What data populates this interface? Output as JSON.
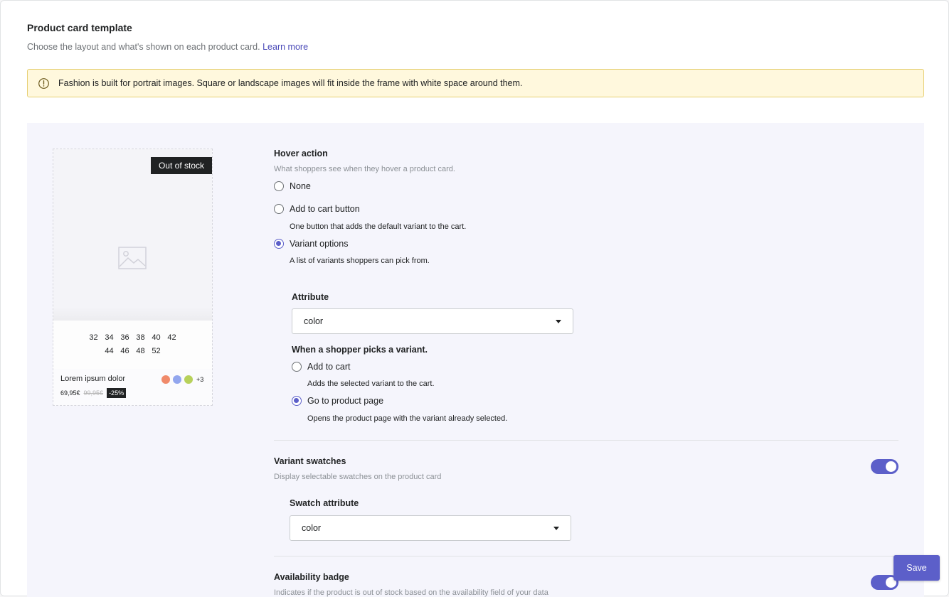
{
  "header": {
    "title": "Product card template",
    "description": "Choose the layout and what's shown on each product card.",
    "learn_more": "Learn more"
  },
  "banner": {
    "icon": "warning-circle-icon",
    "text": "Fashion is built for portrait images. Square or landscape images will fit inside the frame with white space around them."
  },
  "preview": {
    "badge": "Out of stock",
    "image_icon": "image-placeholder-icon",
    "sizes_row1": [
      "32",
      "34",
      "36",
      "38",
      "40",
      "42"
    ],
    "sizes_row2": [
      "44",
      "46",
      "48",
      "52"
    ],
    "product_name": "Lorem ipsum dolor",
    "swatch_colors": [
      "#f08a6a",
      "#92a6ee",
      "#b7d15a"
    ],
    "swatch_more": "+3",
    "price": "69,95€",
    "price_old": "99,95€",
    "discount": "-25%"
  },
  "hover_action": {
    "title": "Hover action",
    "description": "What shoppers see when they hover a product card.",
    "options": [
      {
        "label": "None",
        "help": "",
        "selected": false
      },
      {
        "label": "Add to cart button",
        "help": "One button that adds the default variant to the cart.",
        "selected": false
      },
      {
        "label": "Variant options",
        "help": "A list of variants shoppers can pick from.",
        "selected": true
      }
    ],
    "attribute_label": "Attribute",
    "attribute_value": "color",
    "pick_title": "When a shopper picks a variant.",
    "pick_options": [
      {
        "label": "Add to cart",
        "help": "Adds the selected variant to the cart.",
        "selected": false
      },
      {
        "label": "Go to product page",
        "help": "Opens the product page with the variant already selected.",
        "selected": true
      }
    ]
  },
  "variant_swatches": {
    "title": "Variant swatches",
    "description": "Display selectable swatches on the product card",
    "enabled": true,
    "attribute_label": "Swatch attribute",
    "attribute_value": "color"
  },
  "availability_badge": {
    "title": "Availability badge",
    "description": "Indicates if the product is out of stock based on the availability field of your data",
    "enabled": true
  },
  "actions": {
    "save": "Save"
  },
  "colors": {
    "accent": "#5c5fc9",
    "banner_bg": "#fff8dd",
    "panel_bg": "#f5f5fc"
  }
}
